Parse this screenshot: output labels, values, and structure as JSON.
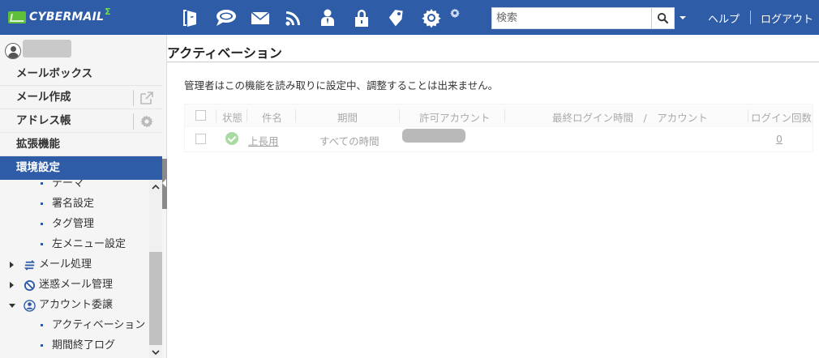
{
  "app": {
    "logo_text": "CYBERMAIL",
    "logo_sup": "Σ"
  },
  "toolbar": {
    "icons": [
      "portal-icon",
      "chat-icon",
      "mail-icon",
      "feed-icon",
      "contacts-icon",
      "lock-icon",
      "tag-icon",
      "gear-icon"
    ],
    "search_placeholder": "検索",
    "help_label": "ヘルプ",
    "logout_label": "ログアウト"
  },
  "sidebar": {
    "items": [
      {
        "label": "メールボックス"
      },
      {
        "label": "メール作成"
      },
      {
        "label": "アドレス帳"
      },
      {
        "label": "拡張機能"
      },
      {
        "label": "環境設定"
      }
    ],
    "sub_items": {
      "theme": "テーマ",
      "signature": "署名設定",
      "tag": "タグ管理",
      "left_menu": "左メニュー設定",
      "mail_processing": "メール処理",
      "spam": "迷惑メール管理",
      "delegation": "アカウント委譲",
      "activation": "アクティベーション",
      "expiry_log": "期間終了ログ"
    }
  },
  "main": {
    "title": "アクティベーション",
    "notice": "管理者はこの機能を読み取りに設定中、調整することは出来ません。",
    "table": {
      "headers": {
        "status": "状態",
        "name": "件名",
        "period": "期間",
        "account": "許可アカウント",
        "last_login": "最終ログイン時間　/　アカウント",
        "login_count": "ログイン回数"
      },
      "rows": [
        {
          "name": "上長用",
          "period": "すべての時間",
          "login_count": "0"
        }
      ]
    }
  }
}
